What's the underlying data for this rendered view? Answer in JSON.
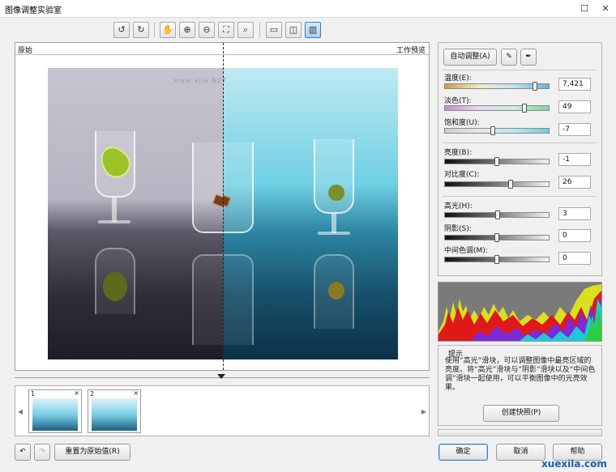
{
  "window": {
    "title": "图像调整实验室",
    "maximize_icon": "maximize-icon",
    "close_icon": "close-icon"
  },
  "toolbar": {
    "icons": [
      "rotate-left-icon",
      "rotate-right-icon",
      "hand-pan-icon",
      "zoom-in-icon",
      "zoom-out-icon",
      "fit-window-icon",
      "actual-size-icon",
      "full-preview-icon",
      "split-before-after-icon",
      "side-by-side-icon"
    ],
    "active": "side-by-side-icon"
  },
  "preview": {
    "left_label": "原始",
    "right_label": "工作预览",
    "watermark": "www.ajia.NET"
  },
  "snapshots": [
    {
      "num": "1",
      "close": "×"
    },
    {
      "num": "2",
      "close": "×"
    }
  ],
  "controls": {
    "auto_adjust": "自动调整(A)",
    "temperature": {
      "label": "温度(E):",
      "value": "7,421",
      "level": 0.86
    },
    "tint": {
      "label": "淡色(T):",
      "value": "49",
      "level": 0.76
    },
    "saturation": {
      "label": "饱和度(U):",
      "value": "-7",
      "level": 0.46
    },
    "brightness": {
      "label": "亮度(B):",
      "value": "-1",
      "level": 0.5
    },
    "contrast": {
      "label": "对比度(C):",
      "value": "26",
      "level": 0.63
    },
    "highlights": {
      "label": "高光(H):",
      "value": "3",
      "level": 0.51
    },
    "shadows": {
      "label": "阴影(S):",
      "value": "0",
      "level": 0.5
    },
    "midtones": {
      "label": "中间色调(M):",
      "value": "0",
      "level": 0.5
    }
  },
  "hint": {
    "title": "提示",
    "text": "使用“高光”滑块，可以调整图像中最亮区域的亮度。将“高光”滑块与“阴影”滑块以及“中间色调”滑块一起使用，可以平衡图像中的光亮效果。",
    "snapshot_button": "创建快照(P)"
  },
  "footer": {
    "reset": "重置为原始值(R)",
    "ok": "确定",
    "cancel": "取消",
    "help": "帮助",
    "site_watermark": "xuexila.com"
  },
  "colors": {
    "accent": "#3c7fb1"
  }
}
